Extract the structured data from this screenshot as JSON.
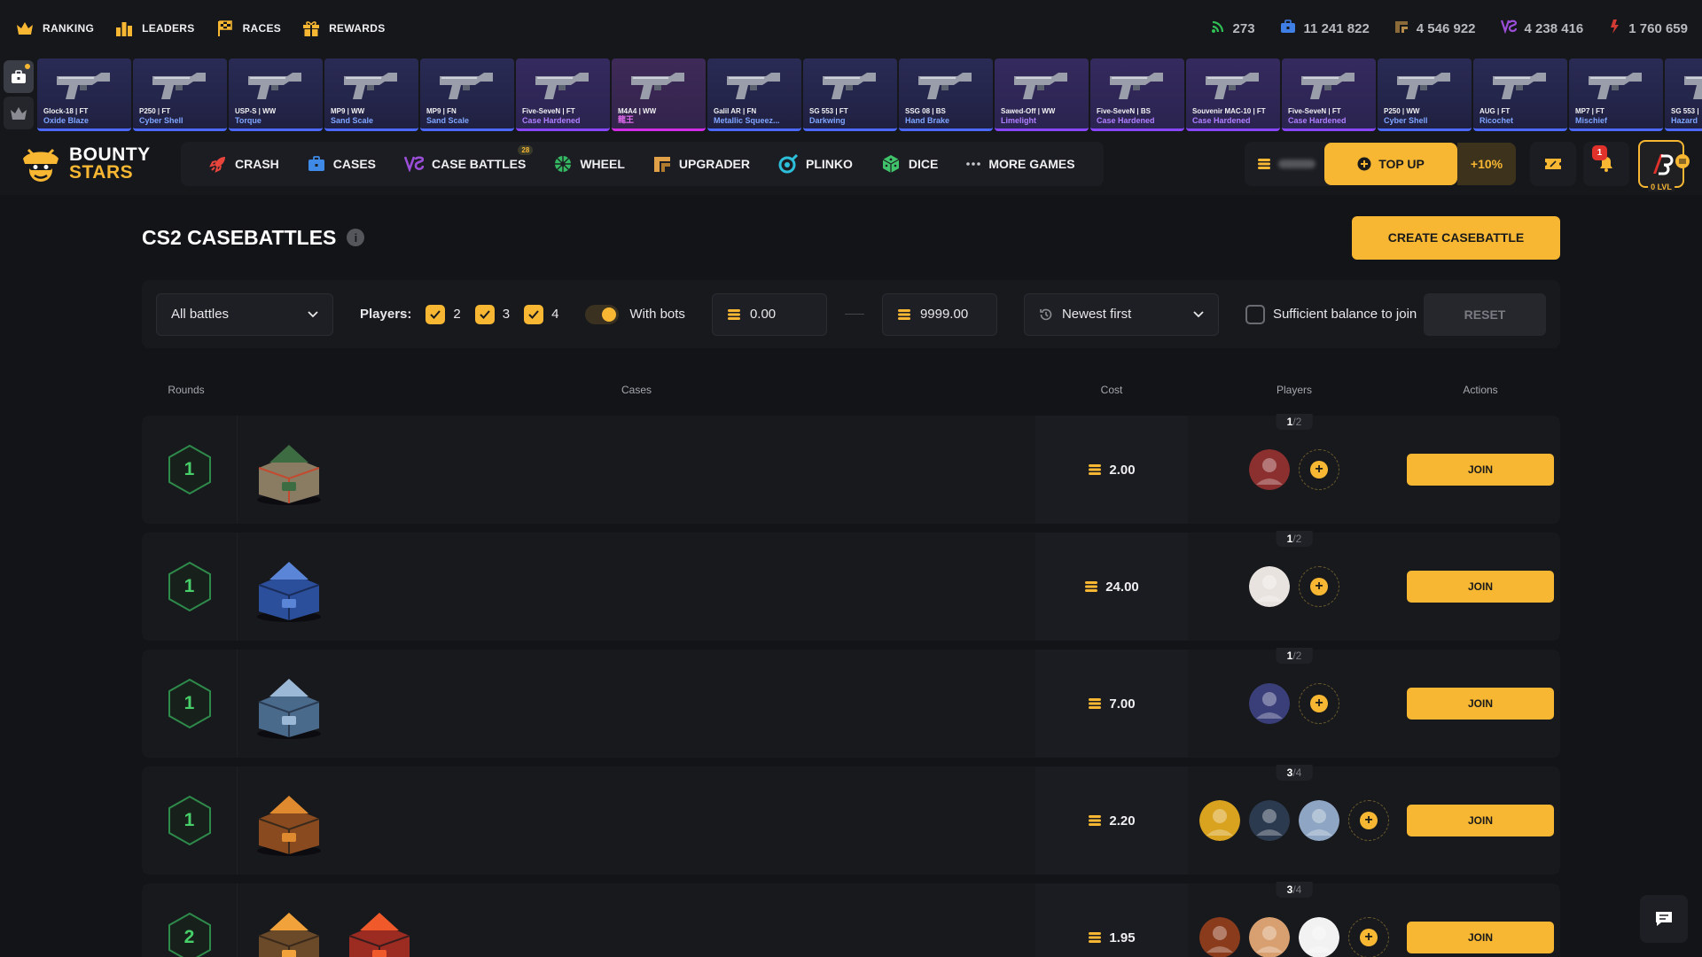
{
  "topnav": {
    "items": [
      {
        "label": "RANKING",
        "icon": "crown-icon"
      },
      {
        "label": "LEADERS",
        "icon": "podium-icon"
      },
      {
        "label": "RACES",
        "icon": "checkered-flag-icon"
      },
      {
        "label": "REWARDS",
        "icon": "gift-icon"
      }
    ],
    "stats": [
      {
        "value": "273",
        "icon": "online-signal-icon",
        "color": "#2fbf55"
      },
      {
        "value": "11 241 822",
        "icon": "case-icon",
        "color": "#3f7fe6"
      },
      {
        "value": "4 546 922",
        "icon": "upgrader-icon",
        "color": "#8a6a38"
      },
      {
        "value": "4 238 416",
        "icon": "versus-icon",
        "color": "#9b4ed8"
      },
      {
        "value": "1 760 659",
        "icon": "contract-icon",
        "color": "#d23a34"
      }
    ]
  },
  "drops": [
    {
      "name": "Glock-18 | FT",
      "skin": "Oxide Blaze",
      "skin_color": "#7fa5ff",
      "rarity": "blue"
    },
    {
      "name": "P250 | FT",
      "skin": "Cyber Shell",
      "skin_color": "#7fa5ff",
      "rarity": "blue"
    },
    {
      "name": "USP-S | WW",
      "skin": "Torque",
      "skin_color": "#7fa5ff",
      "rarity": "blue"
    },
    {
      "name": "MP9 | WW",
      "skin": "Sand Scale",
      "skin_color": "#7fa5ff",
      "rarity": "blue"
    },
    {
      "name": "MP9 | FN",
      "skin": "Sand Scale",
      "skin_color": "#7fa5ff",
      "rarity": "blue"
    },
    {
      "name": "Five-SeveN | FT",
      "skin": "Case Hardened",
      "skin_color": "#b07fff",
      "rarity": "purple"
    },
    {
      "name": "M4A4 | WW",
      "skin": "龍王",
      "skin_color": "#e46cf2",
      "rarity": "pink"
    },
    {
      "name": "Galil AR | FN",
      "skin": "Metallic Squeez...",
      "skin_color": "#7fa5ff",
      "rarity": "blue"
    },
    {
      "name": "SG 553 | FT",
      "skin": "Darkwing",
      "skin_color": "#7fa5ff",
      "rarity": "blue"
    },
    {
      "name": "SSG 08 | BS",
      "skin": "Hand Brake",
      "skin_color": "#7fa5ff",
      "rarity": "blue"
    },
    {
      "name": "Sawed-Off | WW",
      "skin": "Limelight",
      "skin_color": "#b07fff",
      "rarity": "purple"
    },
    {
      "name": "Five-SeveN | BS",
      "skin": "Case Hardened",
      "skin_color": "#b07fff",
      "rarity": "purple"
    },
    {
      "name": "Souvenir MAC-10 | FT",
      "skin": "Case Hardened",
      "skin_color": "#b07fff",
      "rarity": "purple"
    },
    {
      "name": "Five-SeveN | FT",
      "skin": "Case Hardened",
      "skin_color": "#b07fff",
      "rarity": "purple"
    },
    {
      "name": "P250 | WW",
      "skin": "Cyber Shell",
      "skin_color": "#7fa5ff",
      "rarity": "blue"
    },
    {
      "name": "AUG | FT",
      "skin": "Ricochet",
      "skin_color": "#7fa5ff",
      "rarity": "blue"
    },
    {
      "name": "MP7 | FT",
      "skin": "Mischief",
      "skin_color": "#7fa5ff",
      "rarity": "blue"
    },
    {
      "name": "SG 553 |",
      "skin": "Hazard",
      "skin_color": "#7fa5ff",
      "rarity": "blue"
    }
  ],
  "brand": {
    "line1": "BOUNTY",
    "line2": "STARS"
  },
  "games": [
    {
      "label": "CRASH",
      "icon": "rocket-icon",
      "color": "#e8453c"
    },
    {
      "label": "CASES",
      "icon": "case-icon",
      "color": "#3f8ae6"
    },
    {
      "label": "CASE BATTLES",
      "icon": "versus-icon",
      "color": "#9b4ed8",
      "badge": "28"
    },
    {
      "label": "WHEEL",
      "icon": "wheel-icon",
      "color": "#35b862"
    },
    {
      "label": "UPGRADER",
      "icon": "upgrader-icon",
      "color": "#e0a048"
    },
    {
      "label": "PLINKO",
      "icon": "plinko-icon",
      "color": "#2dbfd9"
    },
    {
      "label": "DICE",
      "icon": "dice-icon",
      "color": "#3fc26a"
    },
    {
      "label": "MORE GAMES",
      "icon": "dots-icon",
      "color": "#c8c9ce"
    }
  ],
  "account": {
    "topup_label": "TOP UP",
    "bonus": "+10%",
    "notifications": "1",
    "level": "0 LVL"
  },
  "page": {
    "title": "CS2 CASEBATTLES",
    "create_label": "CREATE CASEBATTLE"
  },
  "filters": {
    "battle_type": "All battles",
    "players_label": "Players:",
    "player_options": [
      "2",
      "3",
      "4"
    ],
    "bots_label": "With bots",
    "min_price": "0.00",
    "max_price": "9999.00",
    "sort": "Newest first",
    "sufficient_label": "Sufficient balance to join",
    "reset_label": "RESET"
  },
  "table": {
    "headers": {
      "rounds": "Rounds",
      "cases": "Cases",
      "cost": "Cost",
      "players": "Players",
      "actions": "Actions"
    },
    "join_label": "JOIN",
    "rows": [
      {
        "rounds": "1",
        "cost": "2.00",
        "joined": "1",
        "max": "2",
        "cases": [
          "house-case"
        ],
        "avatars": [
          "#8b2f2f"
        ]
      },
      {
        "rounds": "1",
        "cost": "24.00",
        "joined": "1",
        "max": "2",
        "cases": [
          "blue-crate-case"
        ],
        "avatars": [
          "#e9e3e0"
        ]
      },
      {
        "rounds": "1",
        "cost": "7.00",
        "joined": "1",
        "max": "2",
        "cases": [
          "tower-case"
        ],
        "avatars": [
          "#3a3f7a"
        ]
      },
      {
        "rounds": "1",
        "cost": "2.20",
        "joined": "3",
        "max": "4",
        "cases": [
          "cs2-crate-case"
        ],
        "avatars": [
          "#d9a21f",
          "#2c3a4f",
          "#8ea6c4"
        ]
      },
      {
        "rounds": "2",
        "cost": "1.95",
        "joined": "3",
        "max": "4",
        "cases": [
          "fire-tank-case",
          "red-chest-case"
        ],
        "avatars": [
          "#8a3b1c",
          "#d8a070",
          "#f2f2f2"
        ]
      }
    ]
  }
}
